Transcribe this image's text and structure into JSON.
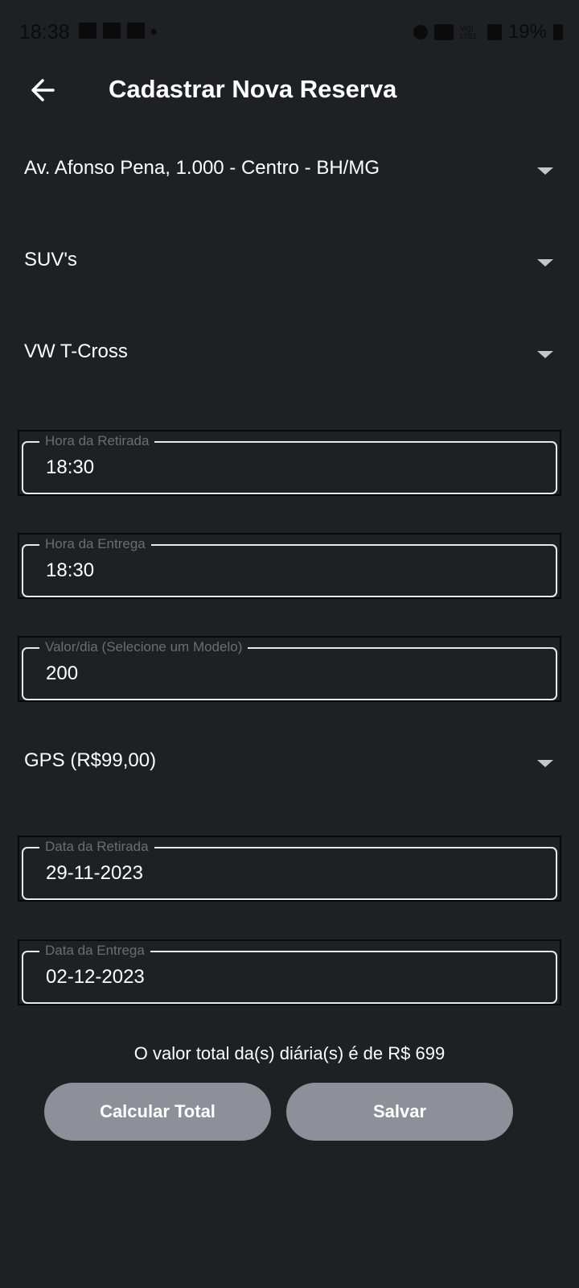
{
  "status_bar": {
    "time": "18:38",
    "network_label": "Vo)) LTE1",
    "battery": "19%"
  },
  "header": {
    "back_icon": "arrow-left-icon",
    "title": "Cadastrar Nova Reserva"
  },
  "form": {
    "address": "Av. Afonso Pena, 1.000 - Centro - BH/MG",
    "category": "SUV's",
    "model": "VW T-Cross",
    "pickup_time": {
      "label": "Hora da Retirada",
      "value": "18:30"
    },
    "return_time": {
      "label": "Hora da Entrega",
      "value": "18:30"
    },
    "daily_rate": {
      "label": "Valor/dia (Selecione um Modelo)",
      "value": "200"
    },
    "extra": "GPS (R$99,00)",
    "pickup_date": {
      "label": "Data da Retirada",
      "value": "29-11-2023"
    },
    "return_date": {
      "label": "Data da Entrega",
      "value": "02-12-2023"
    }
  },
  "summary": {
    "total_text": "O valor total da(s) diária(s) é de R$ 699"
  },
  "actions": {
    "calculate_label": "Calcular Total",
    "save_label": "Salvar"
  },
  "colors": {
    "background": "#1f2024",
    "button": "#8e9099",
    "text": "#ffffff",
    "label": "#6b6d73"
  }
}
